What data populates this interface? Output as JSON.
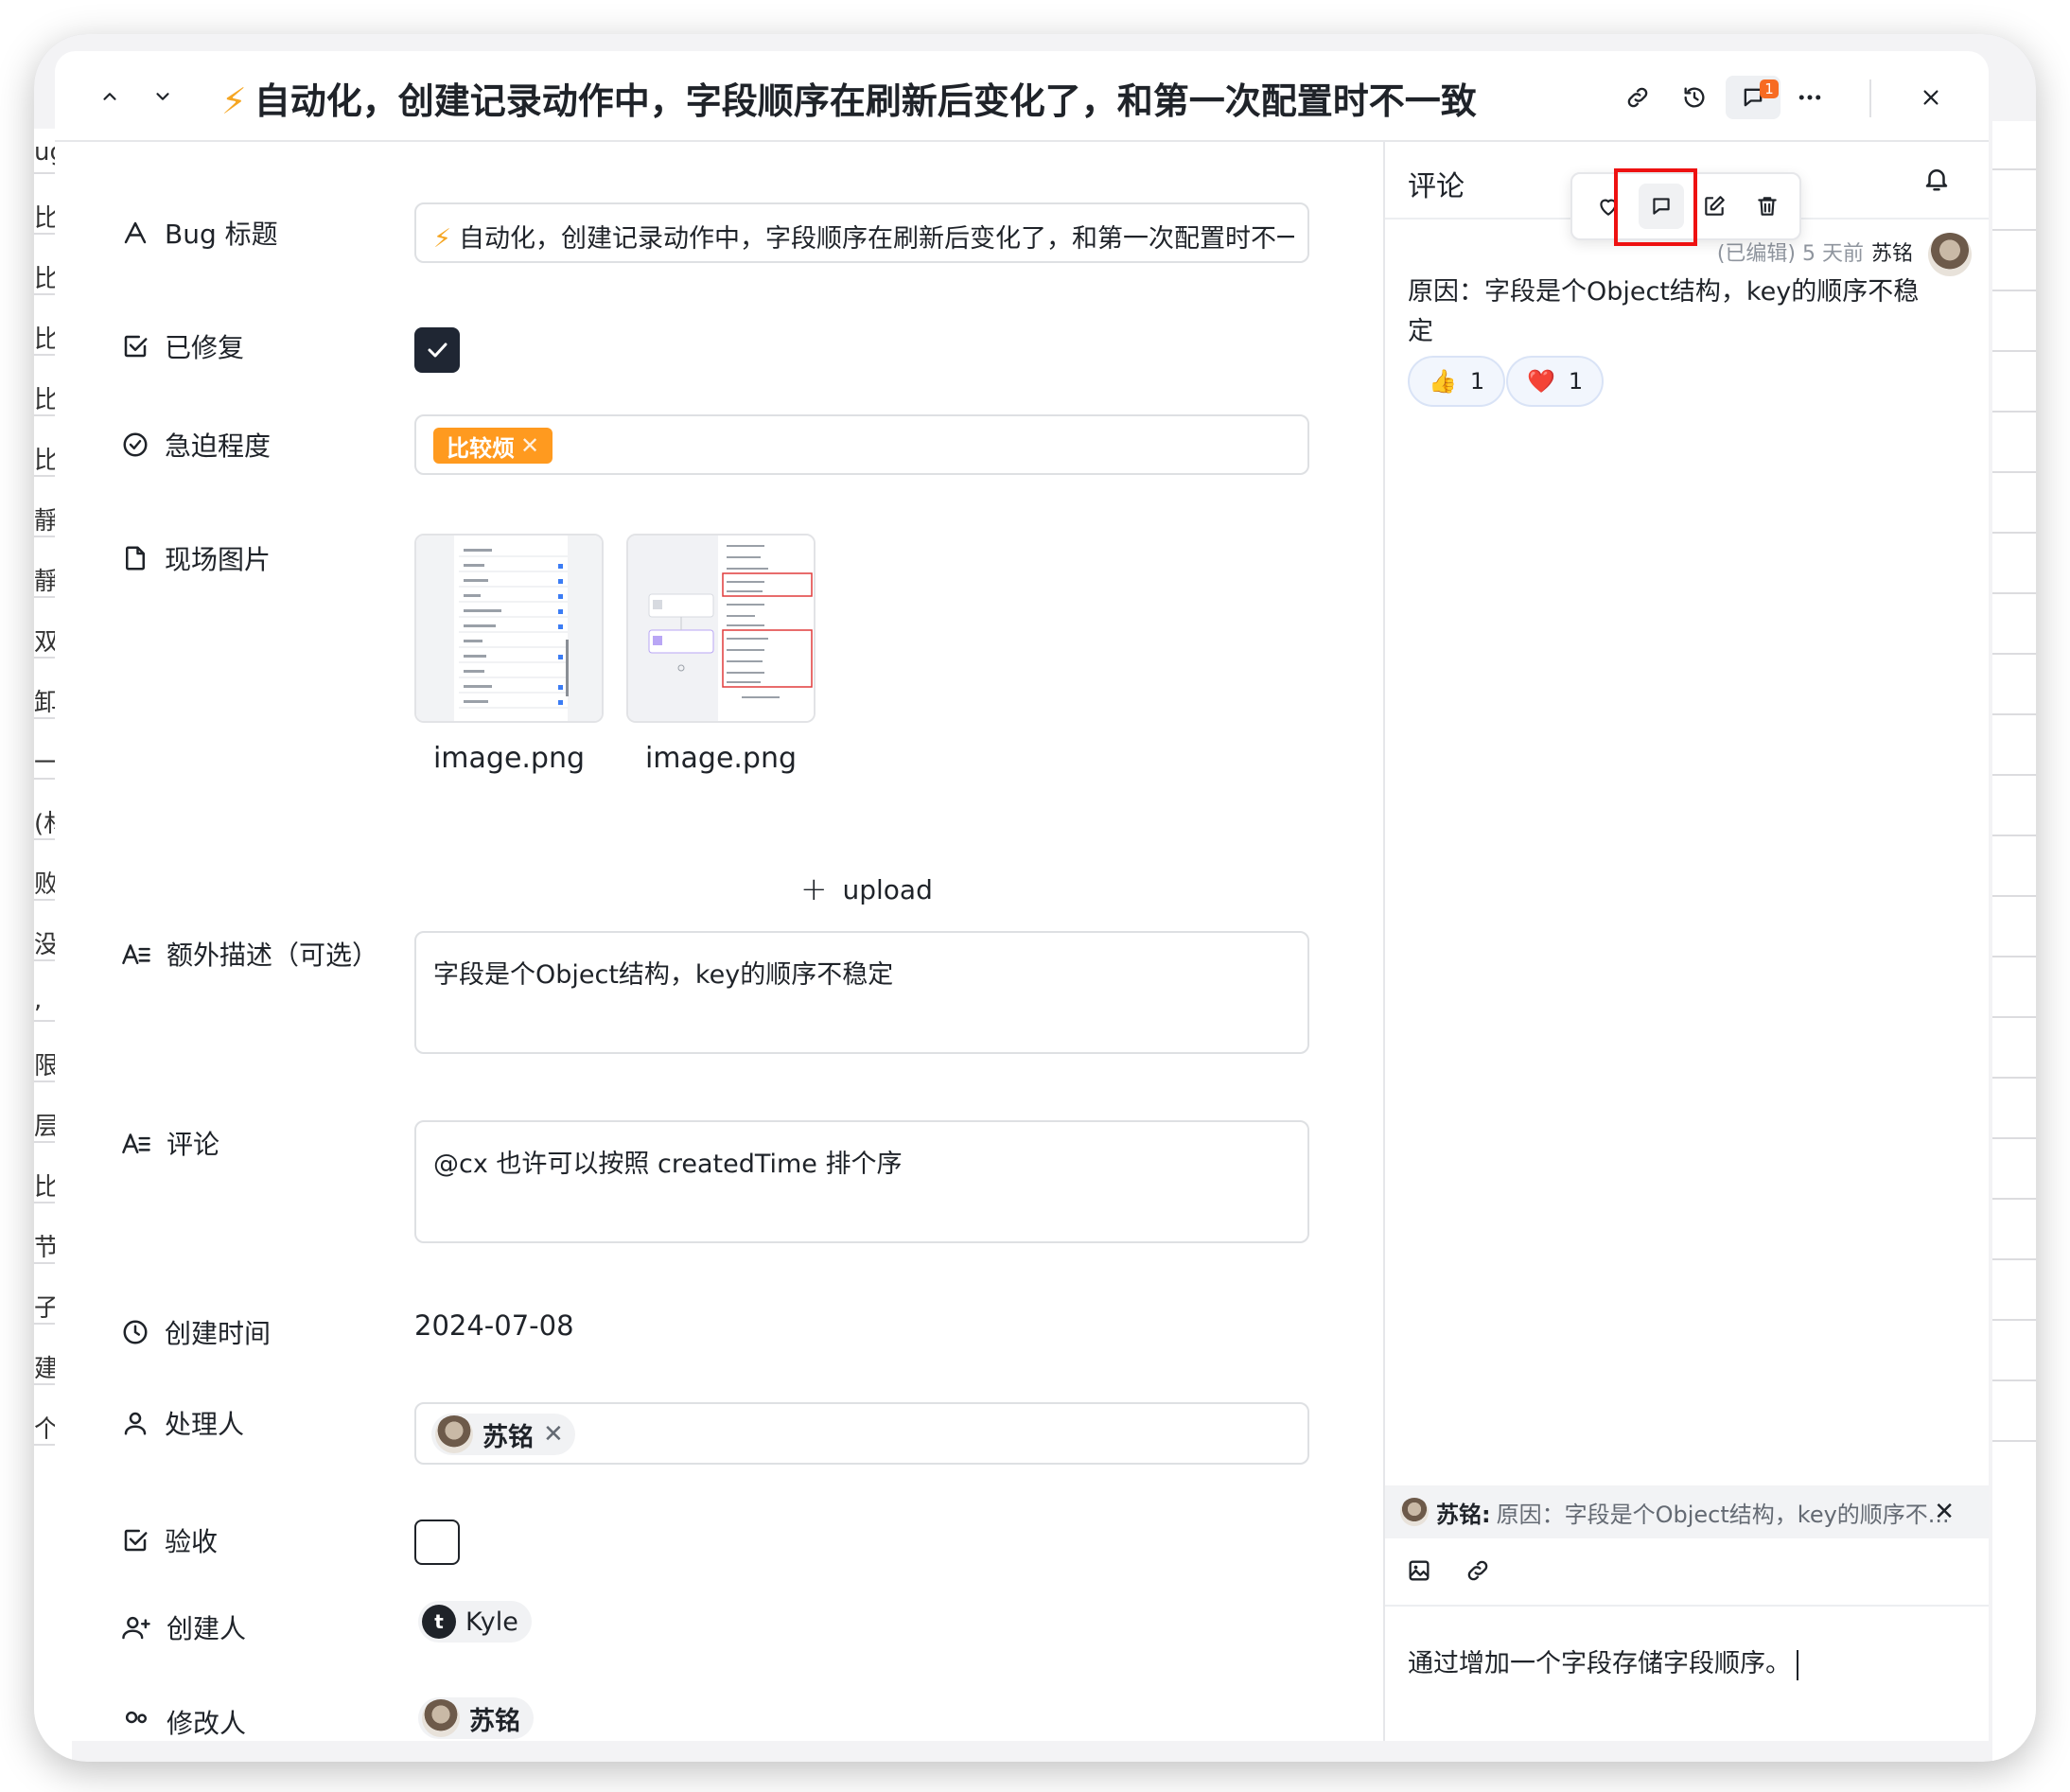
{
  "header": {
    "title": "自动化，创建记录动作中，字段顺序在刷新后变化了，和第一次配置时不一致",
    "comment_badge": "1"
  },
  "background_rows": [
    "ug",
    "比",
    "比,",
    "比,",
    "比,",
    "比",
    "靜",
    "靜",
    "双",
    "卸",
    "一",
    "(材",
    "败",
    "没",
    ",",
    "限",
    "层",
    "比,",
    "节",
    "子",
    "建",
    "个"
  ],
  "fields": {
    "bug_title": {
      "label": "Bug 标题",
      "value": "自动化，创建记录动作中，字段顺序在刷新后变化了，和第一次配置时不一致"
    },
    "fixed": {
      "label": "已修复",
      "checked": true
    },
    "urgency": {
      "label": "急迫程度",
      "tag": "比较烦",
      "tag_color": "#ff9a1f"
    },
    "photos": {
      "label": "现场图片",
      "files": [
        "image.png",
        "image.png"
      ],
      "upload": "upload"
    },
    "description": {
      "label": "额外描述（可选）",
      "value": "字段是个Object结构，key的顺序不稳定"
    },
    "comment": {
      "label": "评论",
      "value": "@cx 也许可以按照 createdTime 排个序"
    },
    "created_time": {
      "label": "创建时间",
      "value": "2024-07-08"
    },
    "assignee": {
      "label": "处理人",
      "name": "苏铭"
    },
    "accepted": {
      "label": "验收",
      "checked": false
    },
    "creator": {
      "label": "创建人",
      "name": "Kyle"
    },
    "modifier": {
      "label": "修改人",
      "name": "苏铭"
    }
  },
  "comments_panel": {
    "title": "评论",
    "meta": "(已编辑) 5 天前",
    "author": "苏铭",
    "body": "原因：字段是个Object结构，key的顺序不稳定",
    "reactions": [
      {
        "emoji": "👍",
        "count": "1"
      },
      {
        "emoji": "❤️",
        "count": "1"
      }
    ],
    "reply_to": {
      "name": "苏铭:",
      "text": "原因：字段是个Object结构，key的顺序不..."
    },
    "draft": "通过增加一个字段存储字段顺序。"
  },
  "colors": {
    "accent_red": "#ee1111",
    "tag_orange": "#ff9a1f",
    "badge_orange": "#f76b22"
  }
}
